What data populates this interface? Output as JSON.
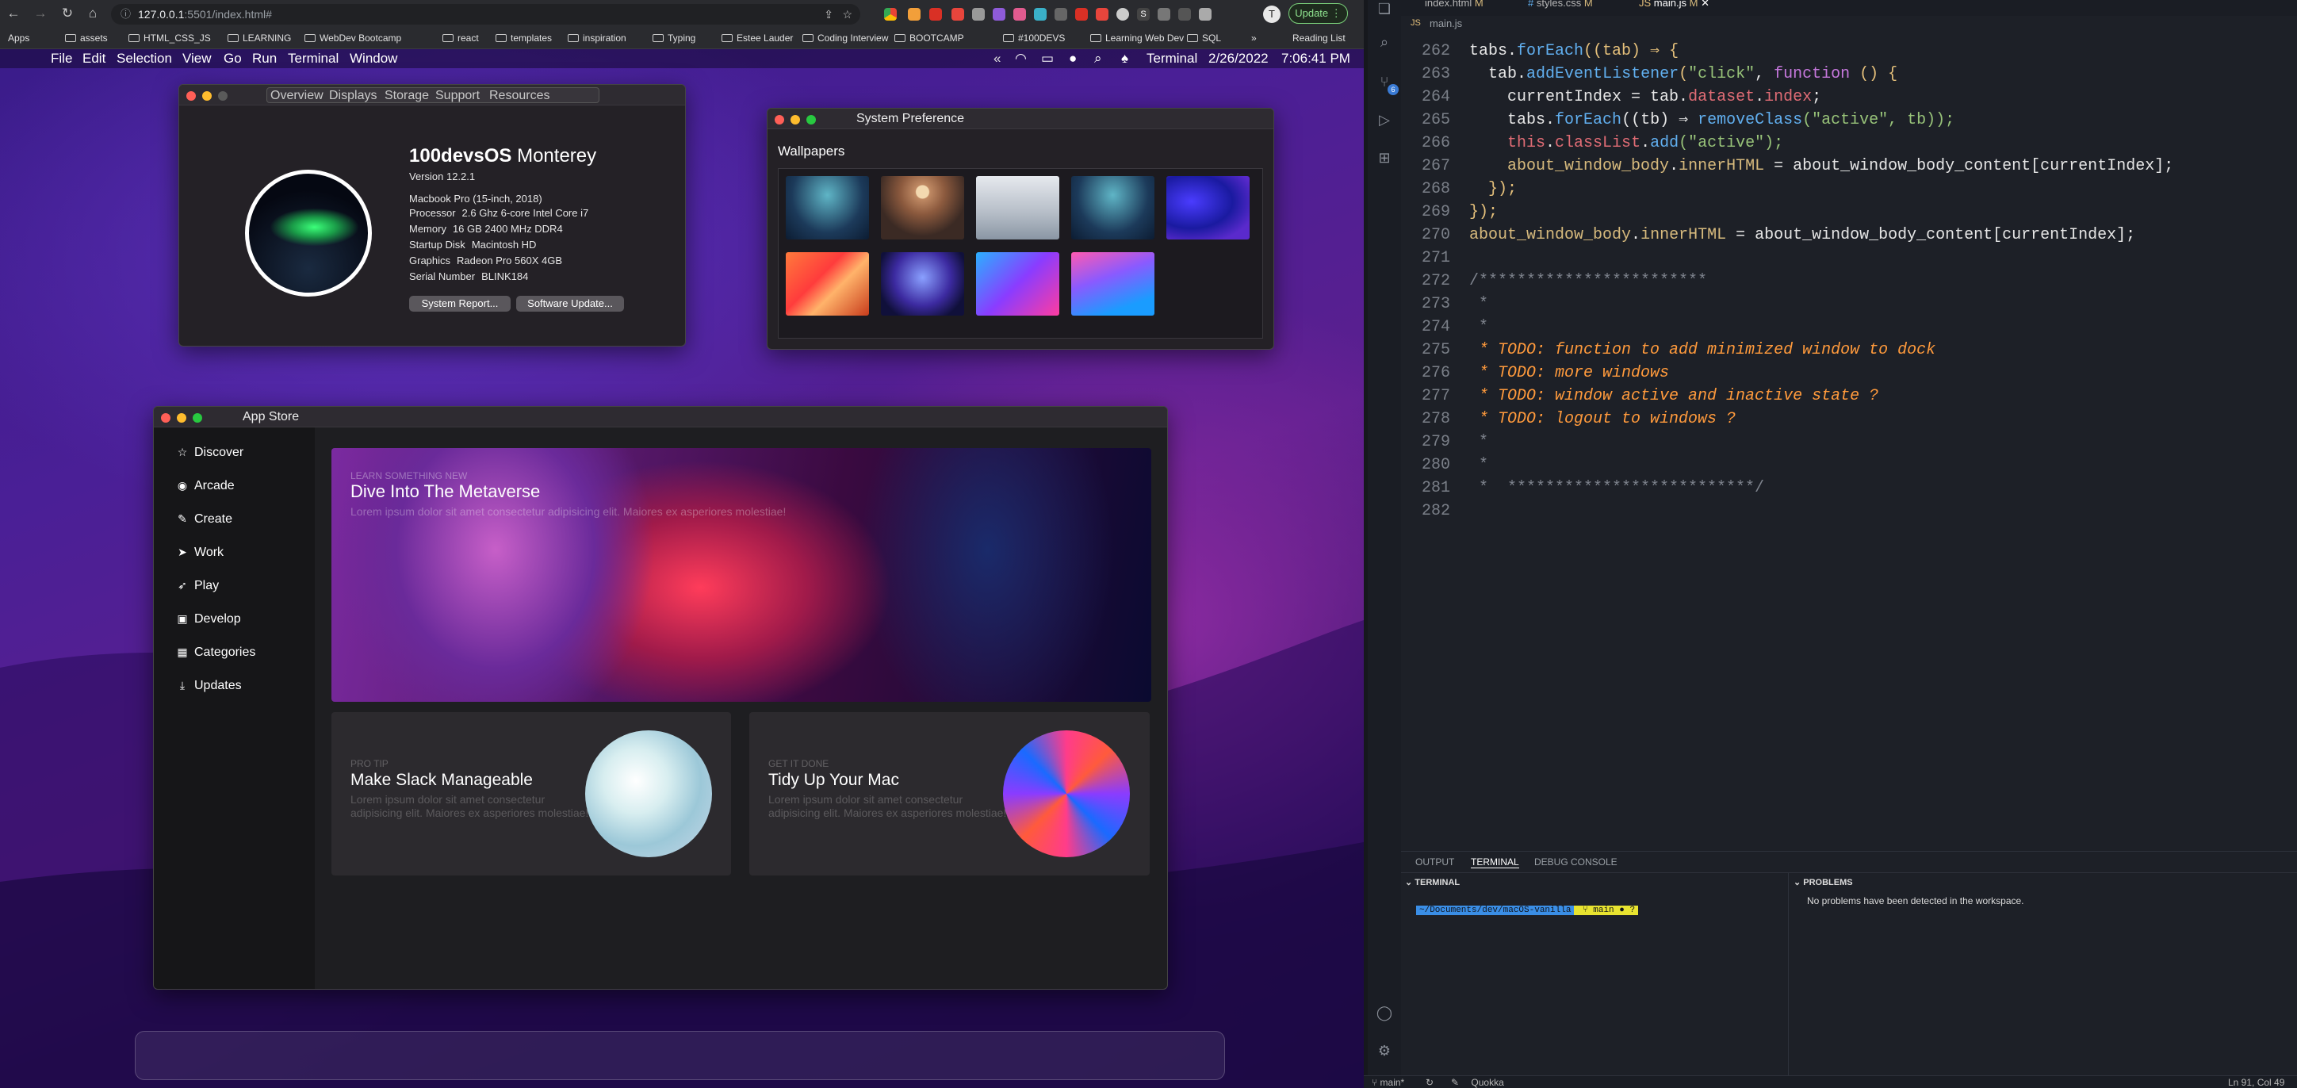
{
  "browser": {
    "url_host": "127.0.0.1",
    "url_rest": ":5501/index.html#",
    "update_label": "Update",
    "bookmarks": [
      "Apps",
      "assets",
      "HTML_CSS_JS",
      "LEARNING",
      "WebDev Bootcamp",
      "react",
      "templates",
      "inspiration",
      "Typing",
      "Estee Lauder",
      "Coding Interview",
      "BOOTCAMP",
      "#100DEVS",
      "Learning Web Dev",
      "SQL",
      "Reading List"
    ],
    "more_label": "»"
  },
  "menubar": {
    "items": [
      "File",
      "Edit",
      "Selection",
      "View",
      "Go",
      "Run",
      "Terminal",
      "Window"
    ],
    "right": {
      "app": "Terminal",
      "date": "2/26/2022",
      "time": "7:06:41 PM",
      "chev": "«"
    }
  },
  "about": {
    "tabs": [
      "Overview",
      "Displays",
      "Storage",
      "Support",
      "Resources"
    ],
    "os_name": "100devsOS",
    "os_version_name": "Monterey",
    "version": "Version 12.2.1",
    "model": "Macbook Pro (15-inch, 2018)",
    "specs": [
      {
        "label": "Processor",
        "value": "2.6 Ghz 6-core Intel Core i7"
      },
      {
        "label": "Memory",
        "value": "16 GB 2400 MHz DDR4"
      },
      {
        "label": "Startup Disk",
        "value": "Macintosh HD"
      },
      {
        "label": "Graphics",
        "value": "Radeon Pro 560X 4GB"
      },
      {
        "label": "Serial Number",
        "value": "BLINK184"
      }
    ],
    "btn_report": "System Report...",
    "btn_update": "Software Update..."
  },
  "sysprefs": {
    "title": "System Preference",
    "heading": "Wallpapers"
  },
  "appstore": {
    "title": "App Store",
    "sidebar": [
      "Discover",
      "Arcade",
      "Create",
      "Work",
      "Play",
      "Develop",
      "Categories",
      "Updates"
    ],
    "hero": {
      "eyebrow": "LEARN SOMETHING NEW",
      "title": "Dive Into The Metaverse",
      "body": "Lorem ipsum dolor sit amet consectetur adipisicing elit. Maiores ex asperiores molestiae!"
    },
    "card1": {
      "eyebrow": "PRO TIP",
      "title": "Make Slack Manageable",
      "body": "Lorem ipsum dolor sit amet consectetur adipisicing elit. Maiores ex asperiores molestiae!"
    },
    "card2": {
      "eyebrow": "GET IT DONE",
      "title": "Tidy Up Your Mac",
      "body": "Lorem ipsum dolor sit amet consectetur adipisicing elit. Maiores ex asperiores molestiae!"
    }
  },
  "vscode": {
    "tabs": [
      "index.html",
      "styles.css",
      "main.js"
    ],
    "tab_flag": "M",
    "breadcrumb": "main.js",
    "lines": {
      "l262": [
        "262",
        "tabs",
        "forEach",
        "((tab) ⇒ {"
      ],
      "l263": [
        "263",
        "tab",
        "addEventListener",
        "\"click\"",
        "function",
        "() {"
      ],
      "l264": [
        "264",
        "currentIndex = tab.",
        "dataset",
        "index",
        ";"
      ],
      "l265": [
        "265",
        "tabs",
        "forEach",
        "((tb) ⇒ ",
        "removeClass",
        "(\"active\", tb));"
      ],
      "l266": [
        "266",
        "this",
        "classList",
        "add",
        "(\"active\");"
      ],
      "l267": [
        "267",
        "about_window_body",
        "innerHTML",
        "about_window_body_content[currentIndex];"
      ],
      "l268": [
        "268",
        "});"
      ],
      "l269": [
        "269",
        "});"
      ],
      "l270": [
        "270",
        "about_window_body",
        "innerHTML",
        "about_window_body_content[currentIndex];"
      ],
      "l271": [
        "271",
        ""
      ],
      "l272": [
        "272",
        "/************************"
      ],
      "l273": [
        "273",
        " *"
      ],
      "l274": [
        "274",
        " *"
      ],
      "l275": [
        "275",
        " * TODO: function to add minimized window to dock"
      ],
      "l276": [
        "276",
        " * TODO: more windows"
      ],
      "l277": [
        "277",
        " * TODO: window active and inactive state ?"
      ],
      "l278": [
        "278",
        " * TODO: logout to windows ?"
      ],
      "l279": [
        "279",
        " *"
      ],
      "l280": [
        "280",
        " *"
      ],
      "l281": [
        "281",
        " *  **************************/"
      ],
      "l282": [
        "282",
        ""
      ]
    },
    "panel_tabs": [
      "OUTPUT",
      "TERMINAL",
      "DEBUG CONSOLE"
    ],
    "terminal_header": "TERMINAL",
    "problems_header": "PROBLEMS",
    "problems_text": "No problems have been detected in the workspace.",
    "prompt_path": "~/Documents/dev/macOS-vanilla",
    "prompt_branch": "main ● ?",
    "status": {
      "branch": "main*",
      "quokka": "Quokka",
      "position": "Ln 91, Col 49"
    },
    "scm_badge": "6"
  }
}
